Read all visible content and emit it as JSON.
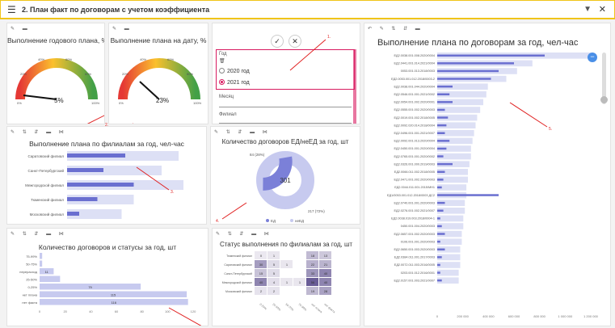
{
  "header": {
    "title": "2. План факт по договорам с учетом коэффициента",
    "menu_icon": "hamburger-icon",
    "filter_icon": "filter-icon",
    "close_icon": "close-icon"
  },
  "annotations": {
    "n1": "1.",
    "n2": "2.",
    "n3": "3.",
    "n4": "4.",
    "n5": "5."
  },
  "gauge_year": {
    "title": "Выполнение годового плана, %",
    "value_label": "5%",
    "ticks": [
      "0%",
      "20%",
      "40%",
      "60%",
      "80%",
      "100%"
    ],
    "value": 5
  },
  "gauge_date": {
    "title": "Выполнение плана на дату, %",
    "value_label": "23%",
    "ticks": [
      "0%",
      "20%",
      "40%",
      "60%",
      "80%",
      "100%"
    ],
    "value": 23
  },
  "filters": {
    "year_label": "Год",
    "options": [
      "2020 год",
      "2021 год"
    ],
    "selected": "2021 год",
    "month_label": "Месяц",
    "branch_label": "Филиал"
  },
  "branch_chart": {
    "title": "Выполнение плана по филиалам за год, чел-час",
    "chart_data": {
      "type": "bar",
      "categories": [
        "Саратовский филиал",
        "Санкт-Петербургский",
        "Межгородской филиал",
        "Тюменский филиал",
        "Московский филиал"
      ],
      "series": [
        {
          "values": [
            0.92,
            0.78,
            0.96,
            0.55,
            0.45
          ]
        },
        {
          "values": [
            0.48,
            0.3,
            0.55,
            0.25,
            0.1
          ]
        }
      ]
    }
  },
  "donut": {
    "title": "Количество договоров ЕД/неЕД за год, шт",
    "center": "301",
    "chart_data": {
      "type": "pie",
      "values": [
        84,
        217
      ],
      "labels": [
        "84 (28%)",
        "217 (72%)"
      ],
      "legend": [
        "ЕД",
        "неЕД"
      ]
    }
  },
  "status_chart": {
    "title": "Количество договоров и статусы за год, шт",
    "chart_data": {
      "type": "bar",
      "categories": [
        "75-99%",
        "50-75%",
        "перерасход",
        "25-50%",
        "0-25%",
        "нет плана",
        "нет факта"
      ],
      "values": [
        2,
        2,
        11,
        16,
        79,
        115,
        116
      ],
      "labels": [
        "",
        "",
        "11",
        "",
        "79",
        "115",
        "116"
      ],
      "xlim": [
        0,
        120
      ],
      "ticks": [
        "0",
        "20",
        "40",
        "60",
        "80",
        "100",
        "120"
      ]
    }
  },
  "heatmap": {
    "title": "Статус выполнения по филиалам за год, шт",
    "rows": [
      "Тюменский филиал",
      "Саратовский филиал",
      "Санкт-Петербургский",
      "Межгородской филиал",
      "Московский филиал"
    ],
    "cells": [
      [
        "0",
        "1",
        "",
        "",
        "18",
        "13"
      ],
      [
        "30",
        "5",
        "1",
        "",
        "22",
        "21"
      ],
      [
        "15",
        "5",
        "",
        "",
        "33",
        "40"
      ],
      [
        "40",
        "4",
        "1",
        "1",
        "56",
        "40"
      ],
      [
        "2",
        "2",
        "",
        "",
        "19",
        "28"
      ]
    ],
    "cols": [
      "0-25%",
      "25-50%",
      "50-75%",
      "75-99%",
      "нет плана",
      "нет факта"
    ]
  },
  "contracts_chart": {
    "title": "Выполнение плана по договорам за год, чел-час",
    "chart_data": {
      "type": "bar",
      "categories": [
        "ЕД2.0038.001.008.2020/0004",
        "ЕД2.0441.001.014.2021/0004",
        "0053.001.013.2018/0003",
        "ЕД2.0053.001.012.2018/0003-2",
        "ЕД2.0038.001.044.2020/0004",
        "ЕД2.0546.001.001.2021/0002",
        "ЕД2.0054.001.002.2020/0001",
        "ЕД2.0555.001.002.2020/0003",
        "ЕД2.0019.001.002.2018/0005",
        "ЕД2.0092.020.014.2018/0004",
        "ЕД2.0496.001.001.2021/0007",
        "ЕД2.0092.001.013.2020/0004",
        "ЕД2.0450.001.001.2020/0004",
        "ЕД2.0765.001.001.2020/0002",
        "ЕД2.0326.001.000.2019/0003",
        "ЕД2.0066.011.002.2018/0005",
        "ЕД2.0471.001.002.2020/0003",
        "ЕД2.0044.011.001.2015/МН1",
        "ЕД1/0053.001.012.2018/0003 ДС2",
        "ЕД2.0740.001.001.2020/0003",
        "ЕД2.0276.001.002.2021/0007",
        "ЕД2.0038.019.003.2018/0004-1",
        "0450.001.004.2020/0003",
        "ЕД2.0657.001.002.2020/0003",
        "0106.001.001.2020/0003",
        "ЕД2.0650.001.003.2020/0003",
        "ЕД2.0384.011.001.2017/0003",
        "ЕД2.0072.011.003.2016/0005",
        "0203.001.012.2016/0001",
        "ЕД2.0157.001.003.2021/0007"
      ],
      "plan": [
        1.0,
        0.62,
        0.52,
        0.45,
        0.33,
        0.32,
        0.3,
        0.28,
        0.26,
        0.25,
        0.24,
        0.23,
        0.22,
        0.22,
        0.21,
        0.2,
        0.2,
        0.19,
        0.19,
        0.18,
        0.18,
        0.17,
        0.17,
        0.16,
        0.16,
        0.15,
        0.15,
        0.15,
        0.14,
        0.14
      ],
      "fact": [
        0.7,
        0.5,
        0.4,
        0.35,
        0.1,
        0.08,
        0.1,
        0.05,
        0.07,
        0.06,
        0.05,
        0.08,
        0.06,
        0.04,
        0.1,
        0.05,
        0.04,
        0.03,
        0.4,
        0.05,
        0.04,
        0.02,
        0.03,
        0.05,
        0.02,
        0.05,
        0.03,
        0.02,
        0.02,
        0.03
      ],
      "ticks": [
        "0",
        "200 000",
        "400 000",
        "600 000",
        "800 000",
        "1 000 000",
        "1 200 000"
      ]
    }
  }
}
